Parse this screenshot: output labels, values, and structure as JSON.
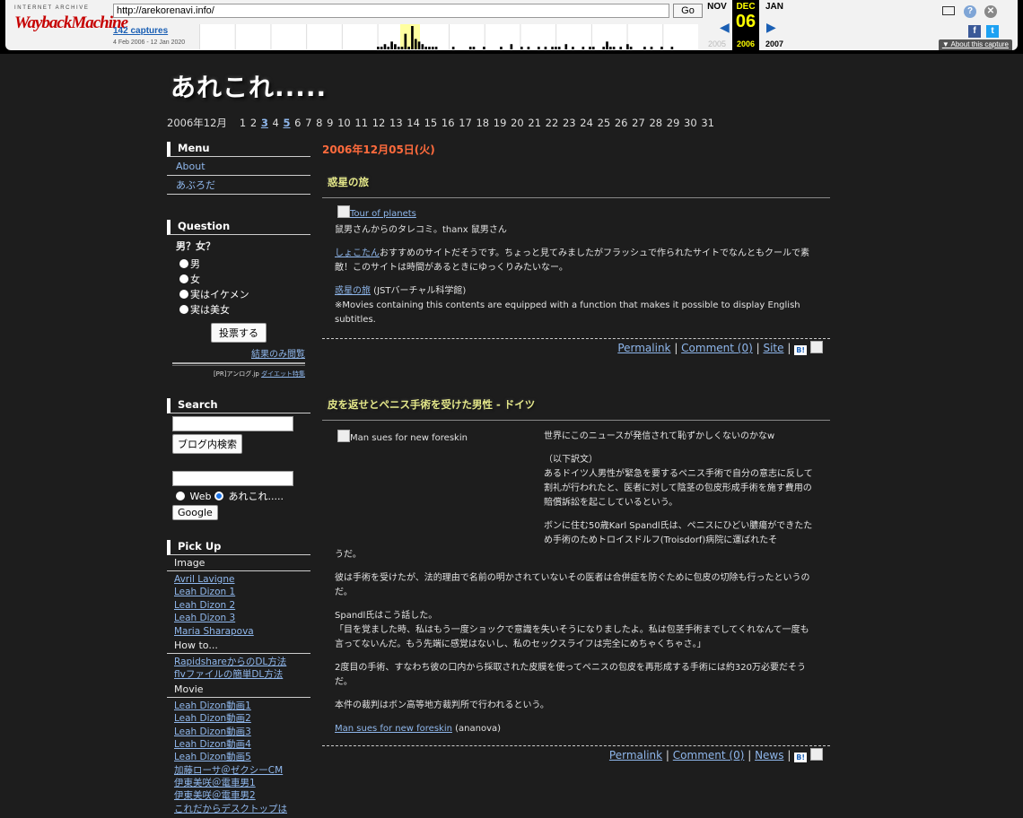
{
  "wayback": {
    "logo_top": "INTERNET ARCHIVE",
    "logo_main": "WaybackMachine",
    "url": "http://arekorenavi.info/",
    "go_label": "Go",
    "captures": "142 captures",
    "range": "4 Feb 2006 - 12 Jan 2020",
    "cal": {
      "prev_month": "NOV",
      "prev_year": "2005",
      "cur_month": "DEC",
      "cur_day": "06",
      "cur_year": "2006",
      "next_month": "JAN",
      "next_year": "2007"
    },
    "about": "About this capture",
    "sparkline": [
      0,
      0,
      0,
      0,
      0,
      0,
      0,
      0,
      0,
      0,
      0,
      0,
      0,
      0,
      0,
      0,
      0,
      0,
      0,
      0,
      0,
      0,
      0,
      0,
      0,
      0,
      0,
      0,
      0,
      0,
      0,
      0,
      0,
      0,
      0,
      0,
      0,
      0,
      0,
      0,
      0,
      0,
      0,
      0,
      0,
      0,
      0,
      0,
      0,
      0,
      0,
      0,
      1,
      1,
      2,
      1,
      3,
      2,
      1,
      1,
      6,
      1,
      9,
      4,
      3,
      2,
      1,
      1,
      1,
      1,
      0,
      0,
      0,
      0,
      1,
      0,
      0,
      0,
      0,
      1,
      1,
      0,
      0,
      1,
      0,
      0,
      0,
      0,
      1,
      0,
      0,
      2,
      0,
      0,
      1,
      0,
      1,
      0,
      0,
      1,
      0,
      1,
      0,
      1,
      1,
      1,
      0,
      2,
      0,
      1,
      0,
      0,
      1,
      0,
      1,
      1,
      0,
      0,
      1,
      3,
      1,
      1,
      0,
      1,
      0,
      2,
      1,
      0,
      0,
      0,
      1,
      0,
      1,
      0,
      0,
      1,
      0,
      0,
      1,
      0,
      0,
      0,
      0,
      0,
      0,
      0
    ]
  },
  "blog": {
    "title": "あれこれ.....",
    "calendar_month": "2006年12月",
    "days": [
      "1",
      "2",
      "3",
      "4",
      "5",
      "6",
      "7",
      "8",
      "9",
      "10",
      "11",
      "12",
      "13",
      "14",
      "15",
      "16",
      "17",
      "18",
      "19",
      "20",
      "21",
      "22",
      "23",
      "24",
      "25",
      "26",
      "27",
      "28",
      "29",
      "30",
      "31"
    ]
  },
  "sidebar": {
    "menu": {
      "heading": "Menu",
      "items": [
        "About",
        "あぶろだ"
      ]
    },
    "question": {
      "heading": "Question",
      "text": "男？女？",
      "options": [
        "男",
        "女",
        "実はイケメン",
        "実は美女"
      ],
      "vote_label": "投票する",
      "results_label": "結果のみ閲覧",
      "pr_prefix": "[PR]アンログ.jp",
      "pr_link": "ダイエット特集"
    },
    "search": {
      "heading": "Search",
      "blog_search_label": "ブログ内検索",
      "google_radio_web": "Web",
      "google_radio_site": "あれこれ.....",
      "google_label": "Google"
    },
    "pickup": {
      "heading": "Pick Up",
      "categories": [
        {
          "name": "Image",
          "links": [
            "Avril Lavigne",
            "Leah Dizon 1",
            "Leah Dizon 2",
            "Leah Dizon 3",
            "Maria Sharapova"
          ]
        },
        {
          "name": "How to...",
          "links": [
            "RapidshareからのDL方法",
            "flvファイルの簡単DL方法"
          ]
        },
        {
          "name": "Movie",
          "links": [
            "Leah Dizon動画1",
            "Leah Dizon動画2",
            "Leah Dizon動画3",
            "Leah Dizon動画4",
            "Leah Dizon動画5",
            "加藤ローサ＠ゼクシーCM",
            "伊東美咲＠電車男1",
            "伊東美咲＠電車男2",
            "これだからデスクトップは"
          ]
        }
      ]
    }
  },
  "main": {
    "date": "2006年12月05日(火)",
    "entries": [
      {
        "title": "惑星の旅",
        "img_alt": "Tour of planets",
        "p1": "鼠男さんからのタレコミ。thanx 鼠男さん",
        "p2_link": "しょこたん",
        "p2": "おすすめのサイトだそうです。ちょっと見てみましたがフラッシュで作られたサイトでなんともクールで素敵！このサイトは時間があるときにゆっくりみたいなー。",
        "p3_link": "惑星の旅",
        "p3_suffix": " (JSTバーチャル科学館)",
        "p3_line2": "※Movies containing this contents are equipped with a function that makes it possible to display English subtitles.",
        "foot": {
          "permalink": "Permalink",
          "comment": "Comment (0)",
          "extra": "Site"
        }
      },
      {
        "title": "皮を返せとペニス手術を受けた男性 - ドイツ",
        "img_alt": "Man sues for new foreskin",
        "right1": "世界にこのニュースが発信されて恥ずかしくないのかなw",
        "right2": "（以下訳文）",
        "right3": "あるドイツ人男性が緊急を要するペニス手術で自分の意志に反して割礼が行われたと、医者に対して陰茎の包皮形成手術を施す費用の賠償訴訟を起こしているという。",
        "right4": "ボンに住む50歳Karl Spandl氏は、ペニスにひどい膿瘍ができたため手術のためトロイスドルフ(Troisdorf)病院に運ばれたそ",
        "p_cont": "うだ。",
        "p5": "彼は手術を受けたが、法的理由で名前の明かされていないその医者は合併症を防ぐために包皮の切除も行ったというのだ。",
        "p6a": "Spandl氏はこう話した。",
        "p6b": "「目を覚ました時、私はもう一度ショックで意識を失いそうになりましたよ。私は包茎手術までしてくれなんて一度も言ってないんだ。もう先端に感覚はないし、私のセックスライフは完全にめちゃくちゃさ。」",
        "p7": "2度目の手術、すなわち彼の口内から採取された皮膜を使ってペニスの包皮を再形成する手術には約320万必要だそうだ。",
        "p8": "本件の裁判はボン高等地方裁判所で行われるという。",
        "p9_link": "Man sues for new foreskin",
        "p9_suffix": " (ananova)",
        "foot": {
          "permalink": "Permalink",
          "comment": "Comment (0)",
          "extra": "News"
        }
      }
    ]
  }
}
